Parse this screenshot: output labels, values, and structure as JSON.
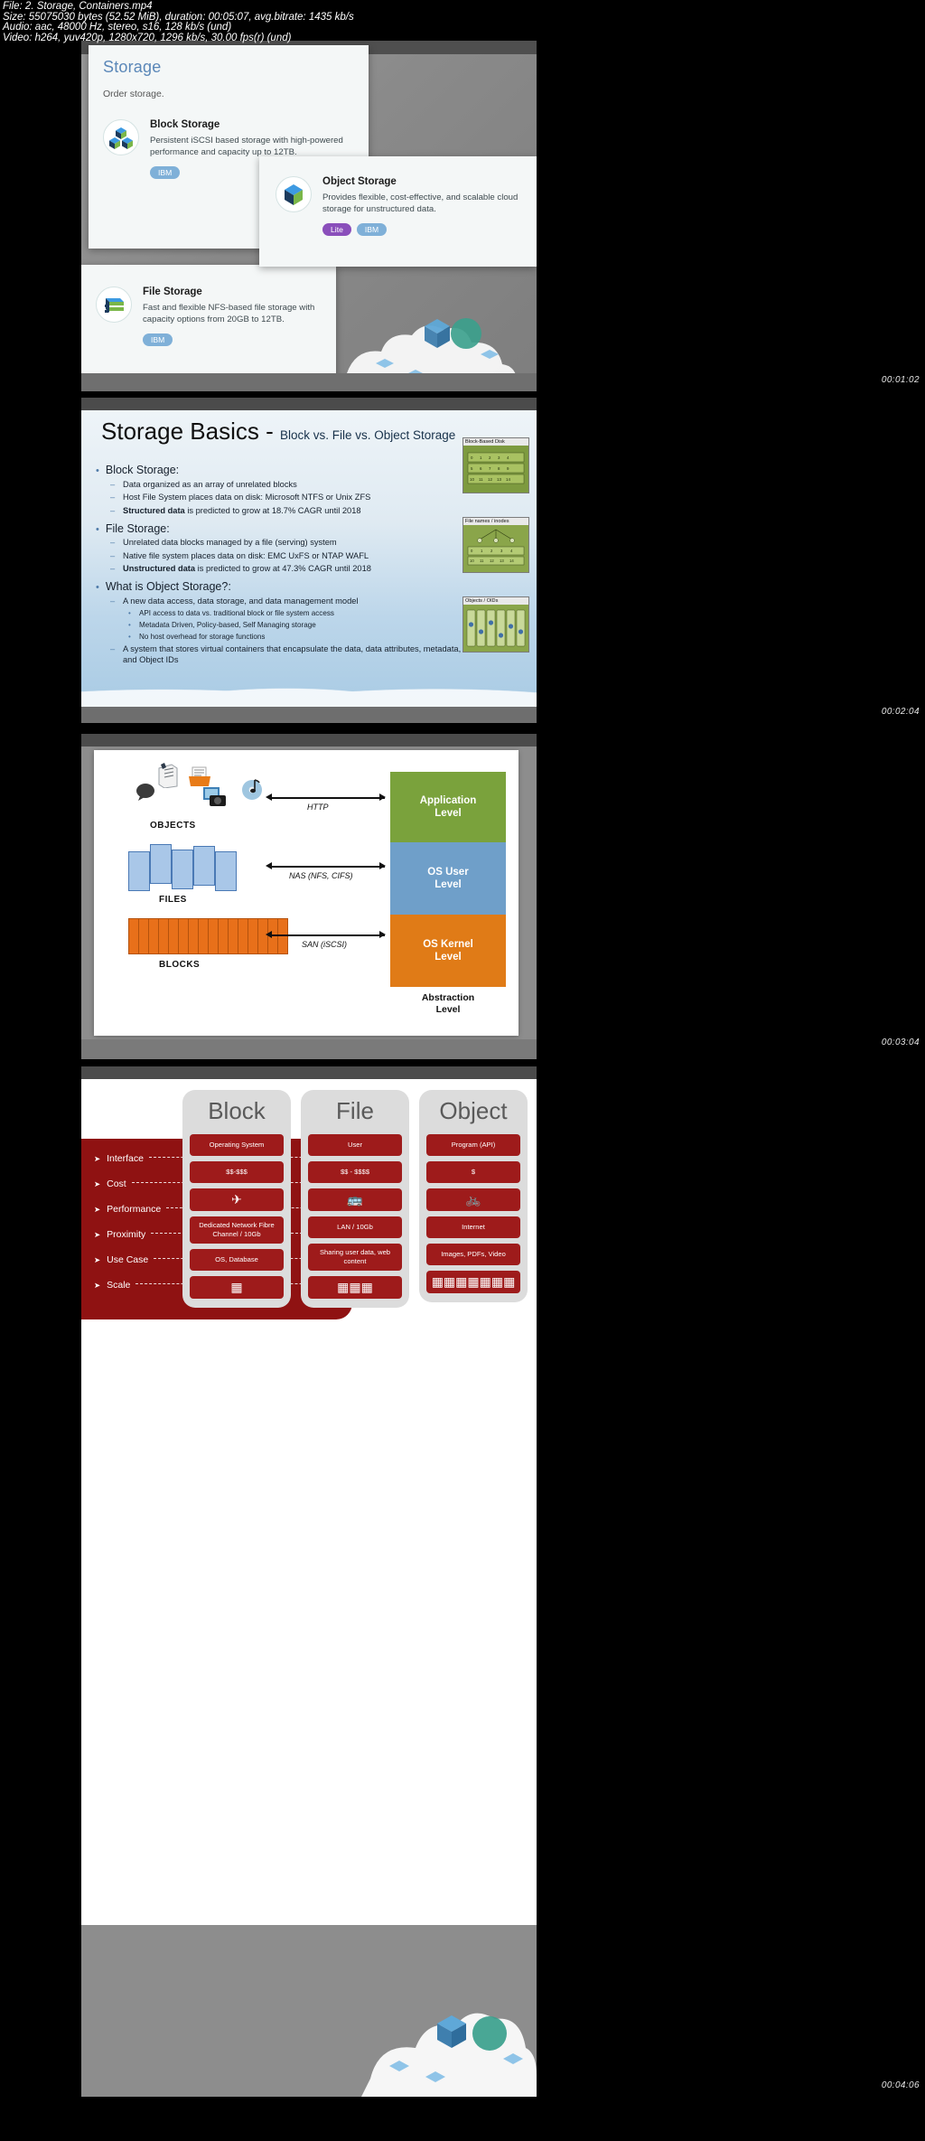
{
  "meta": {
    "line1": "File: 2. Storage, Containers.mp4",
    "line2": "Size: 55075030 bytes (52.52 MiB), duration: 00:05:07, avg.bitrate: 1435 kb/s",
    "line3": "Audio: aac, 48000 Hz, stereo, s16, 128 kb/s (und)",
    "line4": "Video: h264, yuv420p, 1280x720, 1296 kb/s, 30.00 fps(r) (und)"
  },
  "timestamps": {
    "frame1": "00:01:02",
    "frame2": "00:02:04",
    "frame3": "00:03:04",
    "frame4": "00:04:06"
  },
  "frame1": {
    "page_title": "Storage",
    "page_subtitle": "Order storage.",
    "cards": [
      {
        "title": "Block Storage",
        "desc": "Persistent iSCSI based storage with high-powered performance and capacity up to 12TB.",
        "badges": [
          "IBM"
        ],
        "icon": "cubes-icon"
      },
      {
        "title": "Object Storage",
        "desc": "Provides flexible, cost-effective, and scalable cloud storage for unstructured data.",
        "badges": [
          "Lite",
          "IBM"
        ],
        "icon": "cube-3d-icon"
      },
      {
        "title": "File Storage",
        "desc": "Fast and flexible NFS-based file storage with capacity options from 20GB to 12TB.",
        "badges": [
          "IBM"
        ],
        "icon": "layers-icon"
      }
    ],
    "colors": {
      "title": "#5a87b8",
      "badge_ibm": "#7fb0d8",
      "badge_lite": "#8a4fbb"
    }
  },
  "frame2": {
    "title_main": "Storage Basics -",
    "title_sub": "Block vs. File vs. Object Storage",
    "sections": [
      {
        "heading": "Block Storage:",
        "bullets": [
          {
            "text": "Data organized as an array of unrelated blocks",
            "bold": ""
          },
          {
            "text": "Host File System places data on disk:  Microsoft NTFS or Unix ZFS",
            "bold": ""
          },
          {
            "text": "is predicted to grow at 18.7% CAGR until 2018",
            "bold": "Structured data"
          }
        ]
      },
      {
        "heading": "File Storage:",
        "bullets": [
          {
            "text": "Unrelated data blocks managed by a file (serving) system",
            "bold": ""
          },
          {
            "text": "Native file system places data on disk: EMC UxFS or NTAP WAFL",
            "bold": ""
          },
          {
            "text": "is predicted to grow at 47.3% CAGR until 2018",
            "bold": "Unstructured data"
          }
        ]
      },
      {
        "heading": "What is Object Storage?:",
        "bullets": [
          {
            "text": "A new data access, data storage, and data management model",
            "bold": ""
          },
          {
            "text": "A system that stores virtual containers that encapsulate the data, data attributes, metadata, and Object IDs",
            "bold": ""
          }
        ],
        "subbullets": [
          "API access to data vs. traditional block or file system access",
          "Metadata Driven, Policy-based, Self Managing storage",
          "No host overhead for storage functions"
        ]
      }
    ],
    "thumbnails": [
      {
        "caption": "Block-Based Disk"
      },
      {
        "caption": "File names / inodes"
      },
      {
        "caption": "Objects / OIDs"
      }
    ]
  },
  "frame3": {
    "groups": [
      {
        "label": "OBJECTS",
        "protocol": "HTTP"
      },
      {
        "label": "FILES",
        "protocol": "NAS (NFS, CIFS)"
      },
      {
        "label": "BLOCKS",
        "protocol": "SAN (iSCSI)"
      }
    ],
    "stack": [
      {
        "line1": "Application",
        "line2": "Level",
        "color": "#7aa23c"
      },
      {
        "line1": "OS User",
        "line2": "Level",
        "color": "#6f9fc9"
      },
      {
        "line1": "OS Kernel",
        "line2": "Level",
        "color": "#e07b17"
      }
    ],
    "abstraction_label_1": "Abstraction",
    "abstraction_label_2": "Level"
  },
  "frame4": {
    "columns": [
      "Block",
      "File",
      "Object"
    ],
    "rows": [
      {
        "label": "Interface",
        "block": "Operating System",
        "file": "User",
        "object": "Program (API)"
      },
      {
        "label": "Cost",
        "block": "$$-$$$",
        "file": "$$ - $$$$",
        "object": "$"
      },
      {
        "label": "Performance",
        "block": "airplane-icon",
        "file": "bus-icon",
        "object": "bicycle-icon",
        "is_icon": true
      },
      {
        "label": "Proximity",
        "block": "Dedicated Network Fibre Channel / 10Gb",
        "file": "LAN / 10Gb",
        "object": "Internet"
      },
      {
        "label": "Use Case",
        "block": "OS, Database",
        "file": "Sharing user data, web content",
        "object": "Images, PDFs, Video"
      },
      {
        "label": "Scale",
        "block": "scale-1",
        "file": "scale-2",
        "object": "scale-3",
        "is_icon": true
      }
    ],
    "scale_glyphs": {
      "block": "▦",
      "file": "▦▦▦",
      "object": "▦▦▦▦▦▦▦"
    },
    "perf_glyphs": {
      "block": "✈",
      "file": "ὨC",
      "object": "Ὣ2"
    },
    "colors": {
      "panel": "#8f1212",
      "cell": "#9e1b1b",
      "column": "#dcdcdc"
    }
  }
}
